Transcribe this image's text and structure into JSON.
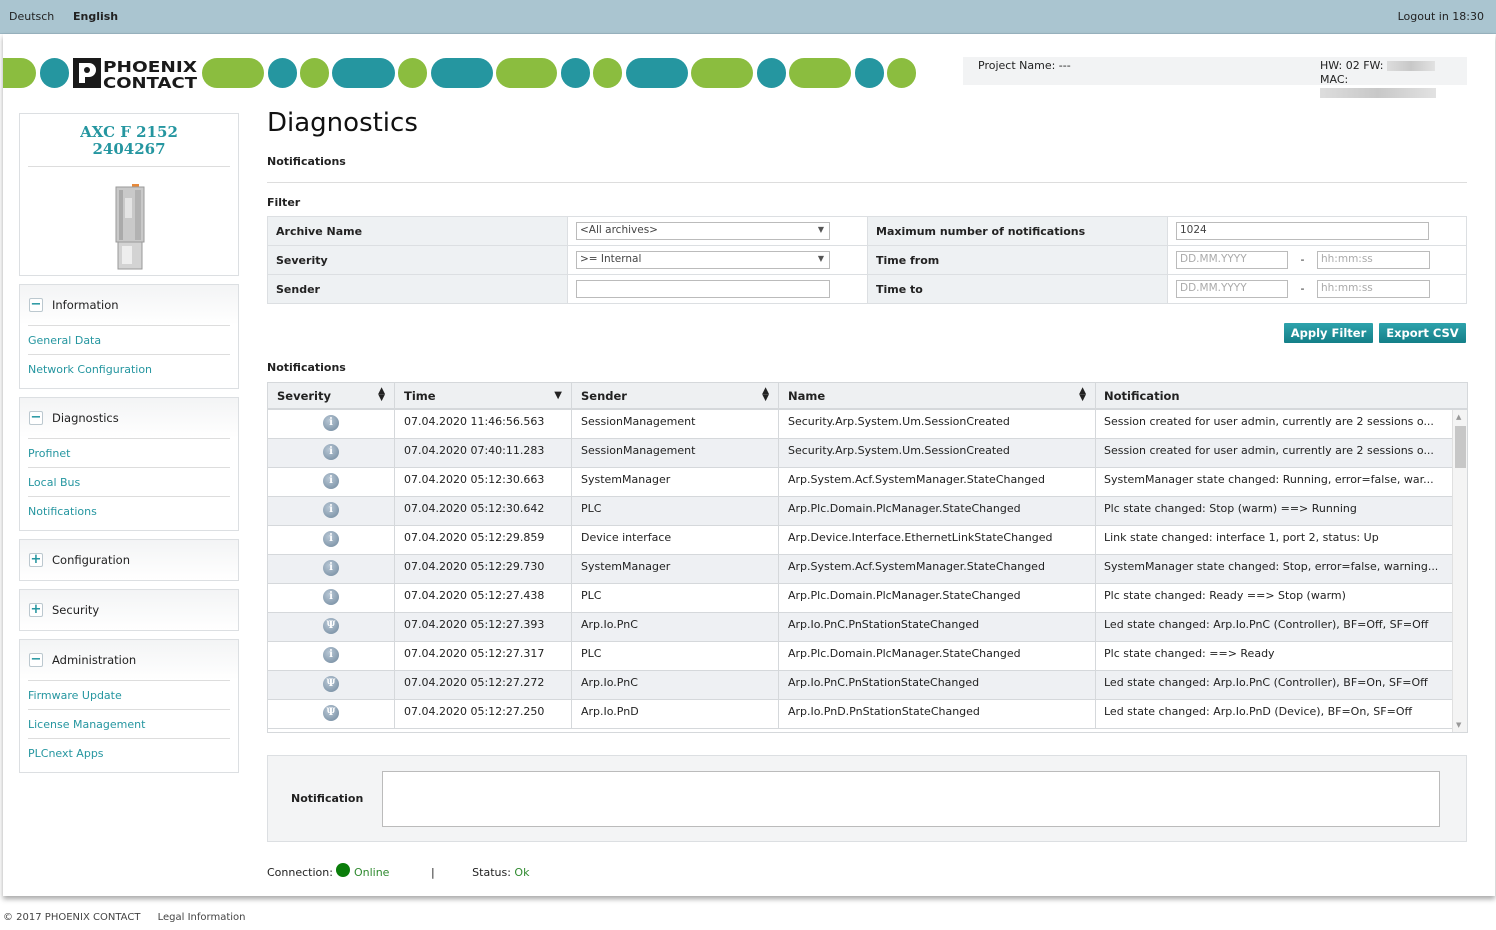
{
  "topbar": {
    "languages": [
      "Deutsch",
      "English"
    ],
    "active_language": "English",
    "logout": "Logout in 18:30"
  },
  "brand": {
    "logo_text": "PHOENIX CONTACT",
    "colors": {
      "green": "#8bbd3f",
      "teal": "#2596a0"
    }
  },
  "header": {
    "project_name": "Project Name: ---",
    "hw_fw": "HW: 02 FW:",
    "mac": "MAC:"
  },
  "device": {
    "name": "AXC F 2152",
    "order_no": "2404267"
  },
  "sidebar": {
    "sections": [
      {
        "title": "Information",
        "expanded": true,
        "items": [
          "General Data",
          "Network Configuration"
        ]
      },
      {
        "title": "Diagnostics",
        "expanded": true,
        "items": [
          "Profinet",
          "Local Bus",
          "Notifications"
        ]
      },
      {
        "title": "Configuration",
        "expanded": false,
        "items": []
      },
      {
        "title": "Security",
        "expanded": false,
        "items": []
      },
      {
        "title": "Administration",
        "expanded": true,
        "items": [
          "Firmware Update",
          "License Management",
          "PLCnext Apps"
        ]
      }
    ]
  },
  "main": {
    "title": "Diagnostics",
    "subtitle": "Notifications",
    "filter_heading": "Filter",
    "filter": {
      "archive_label": "Archive Name",
      "archive_value": "<All archives>",
      "severity_label": "Severity",
      "severity_value": ">= Internal",
      "sender_label": "Sender",
      "sender_value": "",
      "max_label": "Maximum number of notifications",
      "max_value": "1024",
      "from_label": "Time from",
      "to_label": "Time to",
      "date_placeholder": "DD.MM.YYYY",
      "time_placeholder": "hh:mm:ss",
      "separator": "-"
    },
    "buttons": {
      "apply": "Apply Filter",
      "export": "Export CSV"
    },
    "table_heading": "Notifications",
    "columns": [
      "Severity",
      "Time",
      "Sender",
      "Name",
      "Notification"
    ],
    "rows": [
      {
        "severity": "info",
        "time": "07.04.2020 11:46:56.563",
        "sender": "SessionManagement",
        "name": "Security.Arp.System.Um.SessionCreated",
        "notification": "Session created for user admin, currently are 2 sessions o..."
      },
      {
        "severity": "info",
        "time": "07.04.2020 07:40:11.283",
        "sender": "SessionManagement",
        "name": "Security.Arp.System.Um.SessionCreated",
        "notification": "Session created for user admin, currently are 2 sessions o..."
      },
      {
        "severity": "info",
        "time": "07.04.2020 05:12:30.663",
        "sender": "SystemManager",
        "name": "Arp.System.Acf.SystemManager.StateChanged",
        "notification": "SystemManager state changed: Running, error=false, war..."
      },
      {
        "severity": "info",
        "time": "07.04.2020 05:12:30.642",
        "sender": "PLC",
        "name": "Arp.Plc.Domain.PlcManager.StateChanged",
        "notification": "Plc state changed: Stop (warm) ==> Running"
      },
      {
        "severity": "info",
        "time": "07.04.2020 05:12:29.859",
        "sender": "Device interface",
        "name": "Arp.Device.Interface.EthernetLinkStateChanged",
        "notification": "Link state changed: interface 1, port 2, status: Up"
      },
      {
        "severity": "info",
        "time": "07.04.2020 05:12:29.730",
        "sender": "SystemManager",
        "name": "Arp.System.Acf.SystemManager.StateChanged",
        "notification": "SystemManager state changed: Stop, error=false, warning..."
      },
      {
        "severity": "info",
        "time": "07.04.2020 05:12:27.438",
        "sender": "PLC",
        "name": "Arp.Plc.Domain.PlcManager.StateChanged",
        "notification": "Plc state changed: Ready ==> Stop (warm)"
      },
      {
        "severity": "internal",
        "time": "07.04.2020 05:12:27.393",
        "sender": "Arp.Io.PnC",
        "name": "Arp.Io.PnC.PnStationStateChanged",
        "notification": "Led state changed: Arp.Io.PnC (Controller), BF=Off, SF=Off"
      },
      {
        "severity": "info",
        "time": "07.04.2020 05:12:27.317",
        "sender": "PLC",
        "name": "Arp.Plc.Domain.PlcManager.StateChanged",
        "notification": "Plc state changed: ==> Ready"
      },
      {
        "severity": "internal",
        "time": "07.04.2020 05:12:27.272",
        "sender": "Arp.Io.PnC",
        "name": "Arp.Io.PnC.PnStationStateChanged",
        "notification": "Led state changed: Arp.Io.PnC (Controller), BF=On, SF=Off"
      },
      {
        "severity": "internal",
        "time": "07.04.2020 05:12:27.250",
        "sender": "Arp.Io.PnD",
        "name": "Arp.Io.PnD.PnStationStateChanged",
        "notification": "Led state changed: Arp.Io.PnD (Device), BF=On, SF=Off"
      }
    ],
    "detail_label": "Notification",
    "detail_value": ""
  },
  "status": {
    "connection_label": "Connection:",
    "connection_value": "Online",
    "separator": "|",
    "status_label": "Status:",
    "status_value": "Ok",
    "online_color": "#0a7d0a"
  },
  "footer": {
    "copyright": "© 2017 PHOENIX CONTACT",
    "legal": "Legal Information"
  }
}
